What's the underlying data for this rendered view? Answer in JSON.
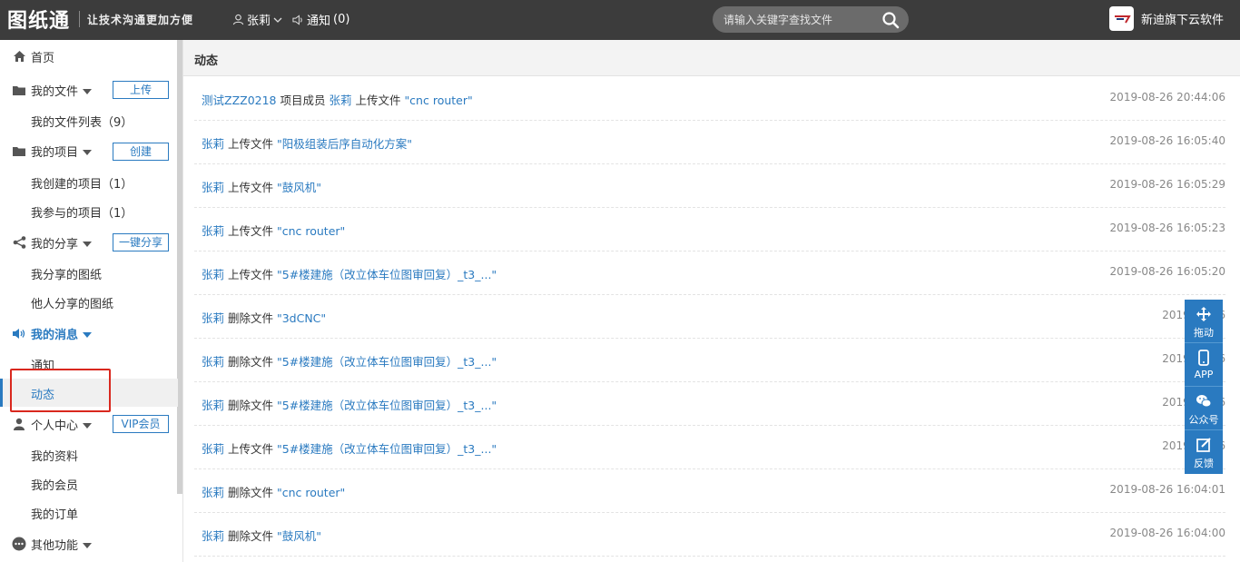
{
  "header": {
    "logo_text": "图纸通",
    "slogan": "让技术沟通更加方便",
    "user_name": "张莉",
    "notify_label": "通知",
    "notify_count": "(0)",
    "search_placeholder": "请输入关键字查找文件",
    "brand_text": "新迪旗下云软件"
  },
  "sidebar": {
    "home": "首页",
    "my_files": "我的文件",
    "upload_btn": "上传",
    "my_file_list": "我的文件列表（9）",
    "my_projects": "我的项目",
    "create_btn": "创建",
    "created_projects": "我创建的项目（1）",
    "joined_projects": "我参与的项目（1）",
    "my_share": "我的分享",
    "one_click_share_btn": "一键分享",
    "my_shared_drawings": "我分享的图纸",
    "others_shared_drawings": "他人分享的图纸",
    "my_messages": "我的消息",
    "notifications": "通知",
    "activity": "动态",
    "personal_center": "个人中心",
    "vip_btn": "VIP会员",
    "my_profile": "我的资料",
    "my_membership": "我的会员",
    "my_orders": "我的订单",
    "other_functions": "其他功能"
  },
  "main": {
    "title": "动态",
    "feed": [
      {
        "actor": "测试ZZZ0218",
        "mid": " 项目成员 ",
        "actor2": "张莉",
        "action": " 上传文件 ",
        "target": "\"cnc router\"",
        "time": "2019-08-26 20:44:06"
      },
      {
        "actor": "张莉",
        "mid": "",
        "actor2": "",
        "action": " 上传文件 ",
        "target": "\"阳极组装后序自动化方案\"",
        "time": "2019-08-26 16:05:40"
      },
      {
        "actor": "张莉",
        "mid": "",
        "actor2": "",
        "action": " 上传文件 ",
        "target": "\"鼓风机\"",
        "time": "2019-08-26 16:05:29"
      },
      {
        "actor": "张莉",
        "mid": "",
        "actor2": "",
        "action": " 上传文件 ",
        "target": "\"cnc router\"",
        "time": "2019-08-26 16:05:23"
      },
      {
        "actor": "张莉",
        "mid": "",
        "actor2": "",
        "action": " 上传文件 ",
        "target": "\"5#楼建施（改立体车位图审回复）_t3_...\"",
        "time": "2019-08-26 16:05:20"
      },
      {
        "actor": "张莉",
        "mid": "",
        "actor2": "",
        "action": " 删除文件 ",
        "target": "\"3dCNC\"",
        "time": "2019-08-26"
      },
      {
        "actor": "张莉",
        "mid": "",
        "actor2": "",
        "action": " 删除文件 ",
        "target": "\"5#楼建施（改立体车位图审回复）_t3_...\"",
        "time": "2019-08-26"
      },
      {
        "actor": "张莉",
        "mid": "",
        "actor2": "",
        "action": " 删除文件 ",
        "target": "\"5#楼建施（改立体车位图审回复）_t3_...\"",
        "time": "2019-08-26"
      },
      {
        "actor": "张莉",
        "mid": "",
        "actor2": "",
        "action": " 上传文件 ",
        "target": "\"5#楼建施（改立体车位图审回复）_t3_...\"",
        "time": "2019-08-26"
      },
      {
        "actor": "张莉",
        "mid": "",
        "actor2": "",
        "action": " 删除文件 ",
        "target": "\"cnc router\"",
        "time": "2019-08-26 16:04:01"
      },
      {
        "actor": "张莉",
        "mid": "",
        "actor2": "",
        "action": " 删除文件 ",
        "target": "\"鼓风机\"",
        "time": "2019-08-26 16:04:00"
      }
    ]
  },
  "float_toolbar": {
    "drag": "拖动",
    "app": "APP",
    "wechat": "公众号",
    "feedback": "反馈"
  },
  "colors": {
    "topbar": "#3c3c3c",
    "accent": "#2a7ac0",
    "highlight": "#d9281e"
  }
}
